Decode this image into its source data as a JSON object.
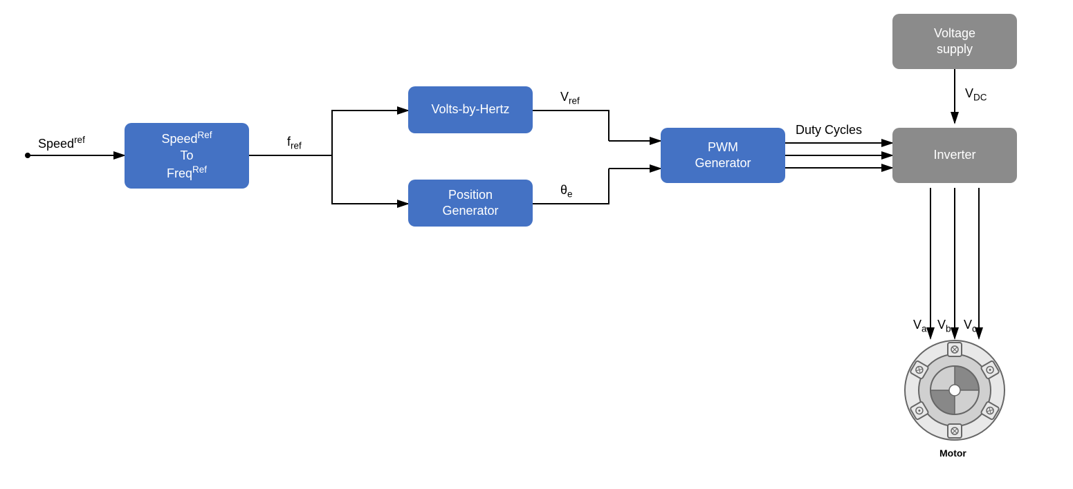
{
  "input": {
    "label_html": "Speed<span class='sup'>ref</span>"
  },
  "blocks": {
    "speed_to_freq": {
      "line1_html": "Speed<span class='sup'>Ref</span>",
      "line2": "To",
      "line3_html": "Freq<span class='sup'>Ref</span>"
    },
    "volts_by_hertz": {
      "label": "Volts-by-Hertz"
    },
    "position_generator": {
      "line1": "Position",
      "line2": "Generator"
    },
    "pwm_generator": {
      "line1": "PWM",
      "line2": "Generator"
    },
    "voltage_supply": {
      "line1": "Voltage",
      "line2": "supply"
    },
    "inverter": {
      "label": "Inverter"
    }
  },
  "signals": {
    "f_ref_html": "f<span class='sub'>ref</span>",
    "v_ref_html": "V<span class='sub'>ref</span>",
    "theta_e_html": "θ<span class='sub'>e</span>",
    "duty_cycles": "Duty Cycles",
    "v_dc_html": "V<span class='sub'>DC</span>",
    "v_a_html": "V<span class='sub'>a</span>",
    "v_b_html": "V<span class='sub'>b</span>",
    "v_c_html": "V<span class='sub'>c</span>"
  },
  "motor": {
    "label": "Motor"
  }
}
